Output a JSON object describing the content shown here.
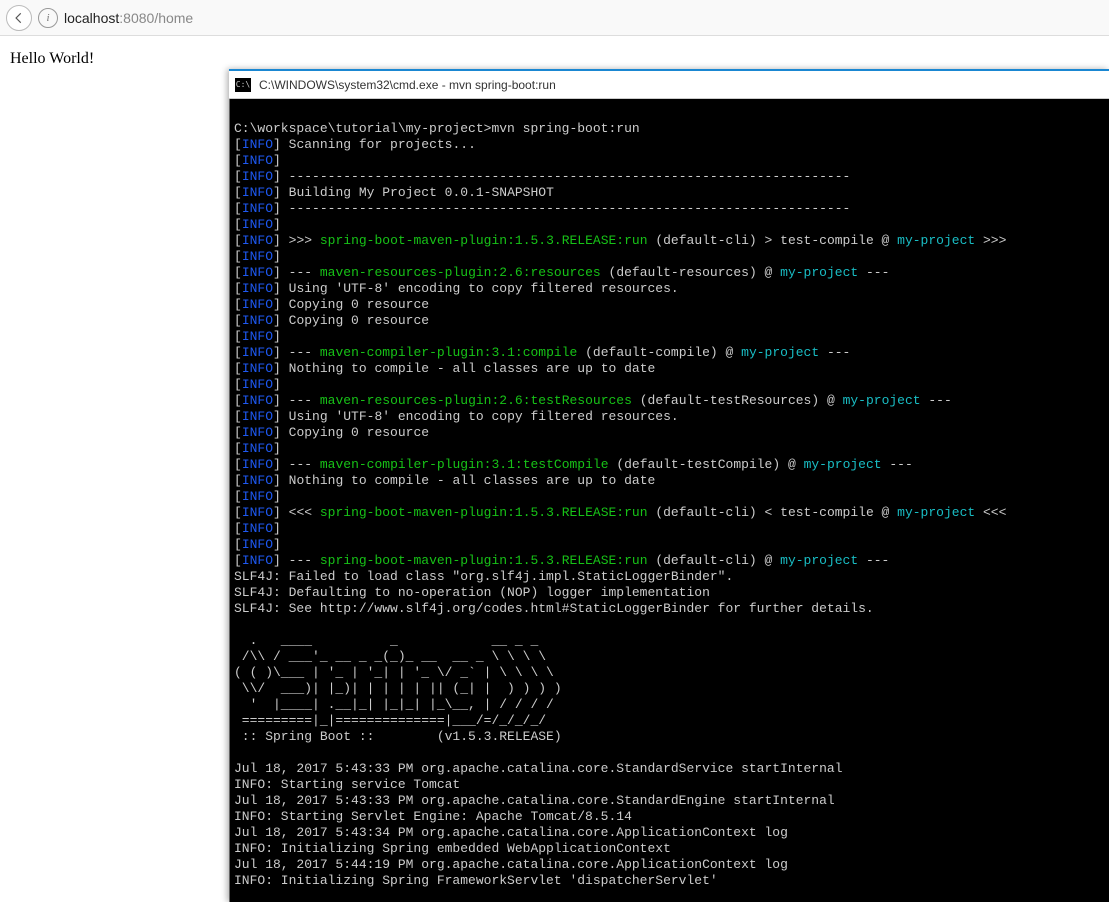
{
  "browser": {
    "url_host": "localhost",
    "url_port": ":8080",
    "url_path": "/home",
    "info_glyph": "i"
  },
  "page": {
    "hello": "Hello World!"
  },
  "cmd": {
    "icon_text": "C:\\",
    "title": "C:\\WINDOWS\\system32\\cmd.exe - mvn  spring-boot:run",
    "prompt_line": "C:\\workspace\\tutorial\\my-project>mvn spring-boot:run",
    "label_info": "INFO",
    "scanning": " Scanning for projects...",
    "dash72": " ------------------------------------------------------------------------",
    "building": " Building My Project 0.0.1-SNAPSHOT",
    "l_run_a": " >>> ",
    "l_run_plugin": "spring-boot-maven-plugin:1.5.3.RELEASE:run",
    "l_run_b": " (default-cli) > test-compile @ ",
    "proj": "my-project",
    "l_run_c": " >>>",
    "l_res_a": " --- ",
    "l_res_plugin": "maven-resources-plugin:2.6:resources",
    "l_res_b": " (default-resources) @ ",
    "l_res_c": " ---",
    "utf8": " Using 'UTF-8' encoding to copy filtered resources.",
    "copy0": " Copying 0 resource",
    "l_comp_plugin": "maven-compiler-plugin:3.1:compile",
    "l_comp_b": " (default-compile) @ ",
    "nothing": " Nothing to compile - all classes are up to date",
    "l_tres_plugin": "maven-resources-plugin:2.6:testResources",
    "l_tres_b": " (default-testResources) @ ",
    "l_tcomp_plugin": "maven-compiler-plugin:3.1:testCompile",
    "l_tcomp_b": " (default-testCompile) @ ",
    "l_run2_b": " (default-cli) < test-compile @ ",
    "l_run2_a": " <<< ",
    "l_run2_c": " <<<",
    "l_fin_b": " (default-cli) @ ",
    "slf1": "SLF4J: Failed to load class \"org.slf4j.impl.StaticLoggerBinder\".",
    "slf2": "SLF4J: Defaulting to no-operation (NOP) logger implementation",
    "slf3": "SLF4J: See http://www.slf4j.org/codes.html#StaticLoggerBinder for further details.",
    "banner1": "  .   ____          _            __ _ _",
    "banner2": " /\\\\ / ___'_ __ _ _(_)_ __  __ _ \\ \\ \\ \\",
    "banner3": "( ( )\\___ | '_ | '_| | '_ \\/ _` | \\ \\ \\ \\",
    "banner4": " \\\\/  ___)| |_)| | | | | || (_| |  ) ) ) )",
    "banner5": "  '  |____| .__|_| |_|_| |_\\__, | / / / /",
    "banner6": " =========|_|==============|___/=/_/_/_/",
    "banner7": " :: Spring Boot ::        (v1.5.3.RELEASE)",
    "log1": "Jul 18, 2017 5:43:33 PM org.apache.catalina.core.StandardService startInternal",
    "log2": "INFO: Starting service Tomcat",
    "log3": "Jul 18, 2017 5:43:33 PM org.apache.catalina.core.StandardEngine startInternal",
    "log4": "INFO: Starting Servlet Engine: Apache Tomcat/8.5.14",
    "log5": "Jul 18, 2017 5:43:34 PM org.apache.catalina.core.ApplicationContext log",
    "log6": "INFO: Initializing Spring embedded WebApplicationContext",
    "log7": "Jul 18, 2017 5:44:19 PM org.apache.catalina.core.ApplicationContext log",
    "log8": "INFO: Initializing Spring FrameworkServlet 'dispatcherServlet'"
  }
}
